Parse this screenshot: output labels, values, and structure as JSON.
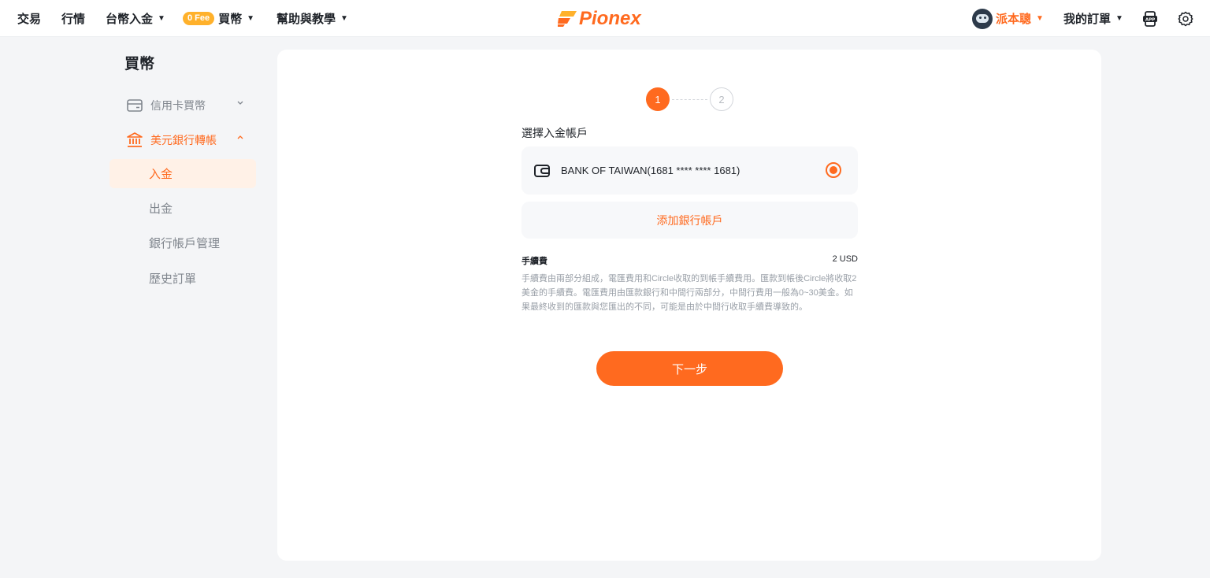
{
  "nav": {
    "trade": "交易",
    "market": "行情",
    "twd_deposit": "台幣入金",
    "fee_badge": "0 Fee",
    "buy_crypto": "買幣",
    "help": "幫助與教學",
    "logo_text": "Pionex",
    "username": "派本聰",
    "my_orders": "我的訂單",
    "app_icon": "app-icon",
    "settings_icon": "gear-icon"
  },
  "sidebar": {
    "title": "買幣",
    "groups": [
      {
        "label": "信用卡買幣",
        "icon": "credit-card-icon",
        "expanded": false
      },
      {
        "label": "美元銀行轉帳",
        "icon": "bank-icon",
        "expanded": true
      }
    ],
    "subitems": [
      {
        "label": "入金",
        "active": true
      },
      {
        "label": "出金",
        "active": false
      },
      {
        "label": "銀行帳戶管理",
        "active": false
      },
      {
        "label": "歷史訂單",
        "active": false
      }
    ]
  },
  "main": {
    "steps": [
      "1",
      "2"
    ],
    "current_step": 1,
    "select_account_label": "選擇入金帳戶",
    "bank_account": "BANK OF TAIWAN(1681 **** **** 1681)",
    "bank_selected": true,
    "add_bank_label": "添加銀行帳戶",
    "fee_label": "手續費",
    "fee_value": "2 USD",
    "fee_description": "手續費由兩部分組成，電匯費用和Circle收取的到帳手續費用。匯款到帳後Circle將收取2美金的手續費。電匯費用由匯款銀行和中間行兩部分，中間行費用一般為0~30美金。如果最終收到的匯款與您匯出的不同，可能是由於中間行收取手續費導致的。",
    "next_button": "下一步"
  },
  "colors": {
    "accent": "#ff6a1f",
    "badge": "#ffb12b",
    "background": "#f4f5f7",
    "card": "#ffffff",
    "muted_text": "#80868e"
  }
}
